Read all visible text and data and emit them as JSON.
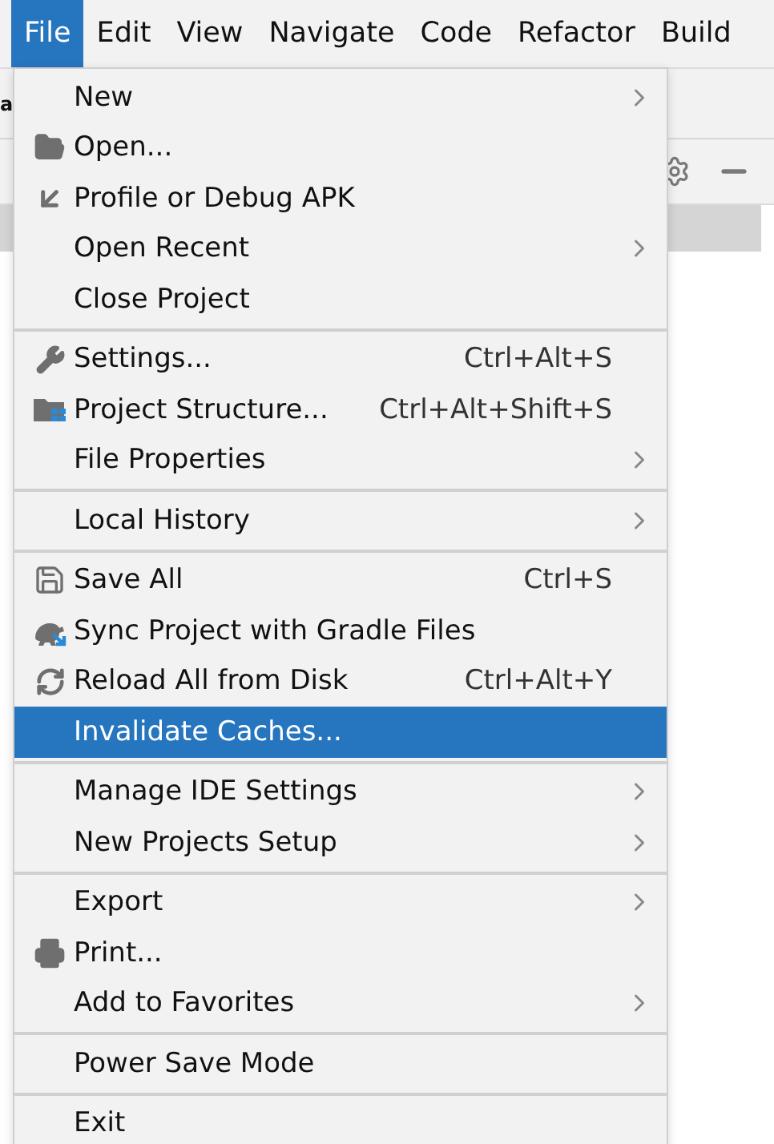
{
  "menu_bar": [
    {
      "label": "File",
      "selected": true
    },
    {
      "label": "Edit",
      "selected": false
    },
    {
      "label": "View",
      "selected": false
    },
    {
      "label": "Navigate",
      "selected": false
    },
    {
      "label": "Code",
      "selected": false
    },
    {
      "label": "Refactor",
      "selected": false
    },
    {
      "label": "Build",
      "selected": false
    }
  ],
  "background": {
    "tab_fragment": "a"
  },
  "file_menu": {
    "groups": [
      {
        "items": [
          {
            "label": "New",
            "kind": "plain",
            "submenu": true,
            "selected": false
          },
          {
            "label": "Open...",
            "kind": "folder",
            "submenu": false,
            "selected": false
          },
          {
            "label": "Profile or Debug APK",
            "kind": "import",
            "submenu": false,
            "selected": false
          },
          {
            "label": "Open Recent",
            "kind": "plain",
            "submenu": true,
            "selected": false
          },
          {
            "label": "Close Project",
            "kind": "plain",
            "submenu": false,
            "selected": false
          }
        ]
      },
      {
        "items": [
          {
            "label": "Settings...",
            "kind": "wrench",
            "shortcut": "Ctrl+Alt+S",
            "submenu": false,
            "selected": false
          },
          {
            "label": "Project Structure...",
            "kind": "structure",
            "shortcut": "Ctrl+Alt+Shift+S",
            "submenu": false,
            "selected": false
          },
          {
            "label": "File Properties",
            "kind": "plain",
            "submenu": true,
            "selected": false
          }
        ]
      },
      {
        "items": [
          {
            "label": "Local History",
            "kind": "plain",
            "submenu": true,
            "selected": false
          }
        ]
      },
      {
        "items": [
          {
            "label": "Save All",
            "kind": "save",
            "shortcut": "Ctrl+S",
            "submenu": false,
            "selected": false
          },
          {
            "label": "Sync Project with Gradle Files",
            "kind": "gradle",
            "submenu": false,
            "selected": false
          },
          {
            "label": "Reload All from Disk",
            "kind": "reload",
            "shortcut": "Ctrl+Alt+Y",
            "submenu": false,
            "selected": false
          },
          {
            "label": "Invalidate Caches...",
            "kind": "plain",
            "submenu": false,
            "selected": true
          }
        ]
      },
      {
        "items": [
          {
            "label": "Manage IDE Settings",
            "kind": "plain",
            "submenu": true,
            "selected": false
          },
          {
            "label": "New Projects Setup",
            "kind": "plain",
            "submenu": true,
            "selected": false
          }
        ]
      },
      {
        "items": [
          {
            "label": "Export",
            "kind": "plain",
            "submenu": true,
            "selected": false
          },
          {
            "label": "Print...",
            "kind": "print",
            "submenu": false,
            "selected": false
          },
          {
            "label": "Add to Favorites",
            "kind": "plain",
            "submenu": true,
            "selected": false
          }
        ]
      },
      {
        "items": [
          {
            "label": "Power Save Mode",
            "kind": "plain",
            "submenu": false,
            "selected": false
          }
        ]
      },
      {
        "items": [
          {
            "label": "Exit",
            "kind": "plain",
            "submenu": false,
            "selected": false
          }
        ]
      }
    ]
  }
}
